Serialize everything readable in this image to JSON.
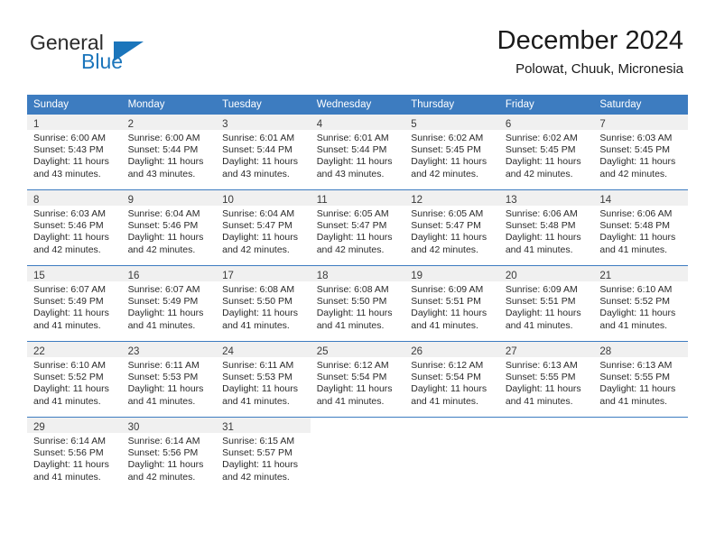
{
  "logo": {
    "word1": "General",
    "word2": "Blue",
    "accent_color": "#1b75bb",
    "triangle_icon": "triangle-icon"
  },
  "header": {
    "month_title": "December 2024",
    "location": "Polowat, Chuuk, Micronesia"
  },
  "calendar": {
    "header_color": "#3d7cc0",
    "daynum_band_color": "#f0f0f0",
    "weekdays": [
      "Sunday",
      "Monday",
      "Tuesday",
      "Wednesday",
      "Thursday",
      "Friday",
      "Saturday"
    ],
    "weeks": [
      [
        {
          "day": "1",
          "info": "Sunrise: 6:00 AM\nSunset: 5:43 PM\nDaylight: 11 hours\nand 43 minutes."
        },
        {
          "day": "2",
          "info": "Sunrise: 6:00 AM\nSunset: 5:44 PM\nDaylight: 11 hours\nand 43 minutes."
        },
        {
          "day": "3",
          "info": "Sunrise: 6:01 AM\nSunset: 5:44 PM\nDaylight: 11 hours\nand 43 minutes."
        },
        {
          "day": "4",
          "info": "Sunrise: 6:01 AM\nSunset: 5:44 PM\nDaylight: 11 hours\nand 43 minutes."
        },
        {
          "day": "5",
          "info": "Sunrise: 6:02 AM\nSunset: 5:45 PM\nDaylight: 11 hours\nand 42 minutes."
        },
        {
          "day": "6",
          "info": "Sunrise: 6:02 AM\nSunset: 5:45 PM\nDaylight: 11 hours\nand 42 minutes."
        },
        {
          "day": "7",
          "info": "Sunrise: 6:03 AM\nSunset: 5:45 PM\nDaylight: 11 hours\nand 42 minutes."
        }
      ],
      [
        {
          "day": "8",
          "info": "Sunrise: 6:03 AM\nSunset: 5:46 PM\nDaylight: 11 hours\nand 42 minutes."
        },
        {
          "day": "9",
          "info": "Sunrise: 6:04 AM\nSunset: 5:46 PM\nDaylight: 11 hours\nand 42 minutes."
        },
        {
          "day": "10",
          "info": "Sunrise: 6:04 AM\nSunset: 5:47 PM\nDaylight: 11 hours\nand 42 minutes."
        },
        {
          "day": "11",
          "info": "Sunrise: 6:05 AM\nSunset: 5:47 PM\nDaylight: 11 hours\nand 42 minutes."
        },
        {
          "day": "12",
          "info": "Sunrise: 6:05 AM\nSunset: 5:47 PM\nDaylight: 11 hours\nand 42 minutes."
        },
        {
          "day": "13",
          "info": "Sunrise: 6:06 AM\nSunset: 5:48 PM\nDaylight: 11 hours\nand 41 minutes."
        },
        {
          "day": "14",
          "info": "Sunrise: 6:06 AM\nSunset: 5:48 PM\nDaylight: 11 hours\nand 41 minutes."
        }
      ],
      [
        {
          "day": "15",
          "info": "Sunrise: 6:07 AM\nSunset: 5:49 PM\nDaylight: 11 hours\nand 41 minutes."
        },
        {
          "day": "16",
          "info": "Sunrise: 6:07 AM\nSunset: 5:49 PM\nDaylight: 11 hours\nand 41 minutes."
        },
        {
          "day": "17",
          "info": "Sunrise: 6:08 AM\nSunset: 5:50 PM\nDaylight: 11 hours\nand 41 minutes."
        },
        {
          "day": "18",
          "info": "Sunrise: 6:08 AM\nSunset: 5:50 PM\nDaylight: 11 hours\nand 41 minutes."
        },
        {
          "day": "19",
          "info": "Sunrise: 6:09 AM\nSunset: 5:51 PM\nDaylight: 11 hours\nand 41 minutes."
        },
        {
          "day": "20",
          "info": "Sunrise: 6:09 AM\nSunset: 5:51 PM\nDaylight: 11 hours\nand 41 minutes."
        },
        {
          "day": "21",
          "info": "Sunrise: 6:10 AM\nSunset: 5:52 PM\nDaylight: 11 hours\nand 41 minutes."
        }
      ],
      [
        {
          "day": "22",
          "info": "Sunrise: 6:10 AM\nSunset: 5:52 PM\nDaylight: 11 hours\nand 41 minutes."
        },
        {
          "day": "23",
          "info": "Sunrise: 6:11 AM\nSunset: 5:53 PM\nDaylight: 11 hours\nand 41 minutes."
        },
        {
          "day": "24",
          "info": "Sunrise: 6:11 AM\nSunset: 5:53 PM\nDaylight: 11 hours\nand 41 minutes."
        },
        {
          "day": "25",
          "info": "Sunrise: 6:12 AM\nSunset: 5:54 PM\nDaylight: 11 hours\nand 41 minutes."
        },
        {
          "day": "26",
          "info": "Sunrise: 6:12 AM\nSunset: 5:54 PM\nDaylight: 11 hours\nand 41 minutes."
        },
        {
          "day": "27",
          "info": "Sunrise: 6:13 AM\nSunset: 5:55 PM\nDaylight: 11 hours\nand 41 minutes."
        },
        {
          "day": "28",
          "info": "Sunrise: 6:13 AM\nSunset: 5:55 PM\nDaylight: 11 hours\nand 41 minutes."
        }
      ],
      [
        {
          "day": "29",
          "info": "Sunrise: 6:14 AM\nSunset: 5:56 PM\nDaylight: 11 hours\nand 41 minutes."
        },
        {
          "day": "30",
          "info": "Sunrise: 6:14 AM\nSunset: 5:56 PM\nDaylight: 11 hours\nand 42 minutes."
        },
        {
          "day": "31",
          "info": "Sunrise: 6:15 AM\nSunset: 5:57 PM\nDaylight: 11 hours\nand 42 minutes."
        },
        {
          "day": "",
          "info": ""
        },
        {
          "day": "",
          "info": ""
        },
        {
          "day": "",
          "info": ""
        },
        {
          "day": "",
          "info": ""
        }
      ]
    ]
  }
}
